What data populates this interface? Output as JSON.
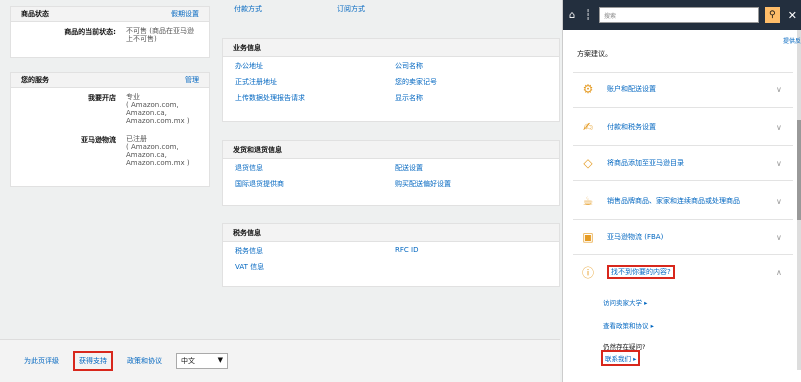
{
  "left": {
    "listing": {
      "title": "商品状态",
      "edit": "假期设置",
      "key": "商品的当前状态:",
      "value": "不可售 (商品在亚马逊上不可售)"
    },
    "services": {
      "title": "您的服务",
      "manage": "管理",
      "rows": [
        {
          "key": "我要开店",
          "value": "专业\n( Amazon.com,\nAmazon.ca,\nAmazon.com.mx )"
        },
        {
          "key": "亚马逊物流",
          "value": "已注册\n( Amazon.com,\nAmazon.ca,\nAmazon.com.mx )"
        }
      ]
    }
  },
  "middle": {
    "top_links": [
      "付款方式",
      "订阅方式"
    ],
    "business": {
      "title": "业务信息",
      "links": [
        "办公地址",
        "公司名称",
        "正式注册地址",
        "您的卖家记号",
        "上传数据处理报告请求",
        "显示名称"
      ]
    },
    "shipping": {
      "title": "发货和退货信息",
      "links": [
        "退货信息",
        "配送设置",
        "国际退货提供商",
        "购买配送偏好设置"
      ]
    },
    "tax": {
      "title": "税务信息",
      "links": [
        "税务信息",
        "RFC ID",
        "VAT 信息",
        ""
      ]
    }
  },
  "footer": {
    "feedback": "为此页评级",
    "support": "获得支持",
    "policies": "政策和协议",
    "language": "中文"
  },
  "help": {
    "search_placeholder": "搜索",
    "sub_link": "提供反",
    "intro": "方案建议。",
    "items": [
      {
        "label": "账户和配送设置",
        "icon": "gear-icon"
      },
      {
        "label": "付款和税务设置",
        "icon": "hand-coin-icon"
      },
      {
        "label": "将商品添加至亚马逊目录",
        "icon": "tag-icon"
      },
      {
        "label": "销售品牌商品、家家和连续商品或处理商品",
        "icon": "teapot-icon"
      },
      {
        "label": "亚马逊物流 (FBA)",
        "icon": "box-icon"
      },
      {
        "label": "找不到你要的内容?",
        "icon": "question-icon"
      }
    ],
    "sublinks": [
      "访问卖家大学 ▸",
      "查看政策和协议 ▸"
    ],
    "still_question": "仍然存在疑问?",
    "contact": "联系我们 ▸"
  }
}
